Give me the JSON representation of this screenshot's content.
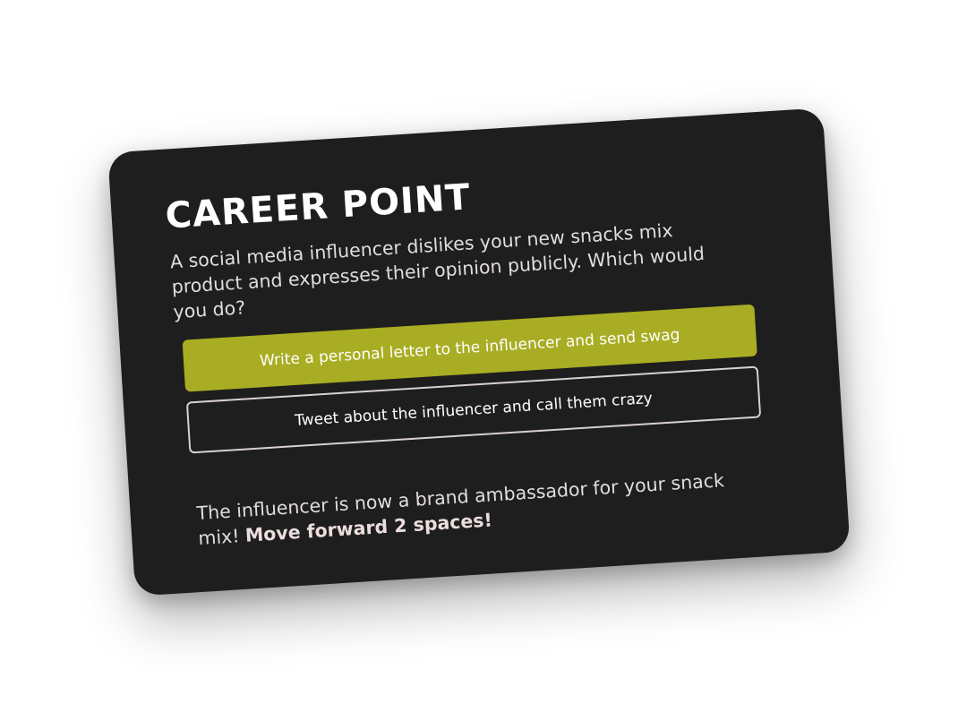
{
  "card": {
    "title": "CAREER POINT",
    "question": "A social media influencer dislikes your new snacks mix product and expresses their opinion publicly. Which would you do?",
    "options": [
      {
        "label": "Write a personal letter to the influencer and send swag",
        "selected": true
      },
      {
        "label": "Tweet about the influencer and call them crazy",
        "selected": false
      }
    ],
    "result": {
      "text": "The influencer is now a brand ambassador for your snack mix! ",
      "emphasis": "Move forward 2 spaces!"
    }
  },
  "colors": {
    "card_background": "#1e1e1e",
    "selected_option": "#a9ad23",
    "option_border": "#d9d0d0",
    "text": "#e2dcdc"
  }
}
